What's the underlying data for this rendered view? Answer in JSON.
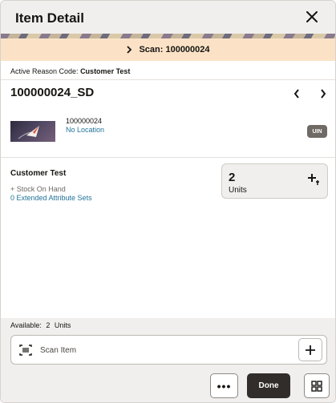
{
  "dialog": {
    "title": "Item Detail",
    "close_icon": "close-icon"
  },
  "scan_banner": {
    "label": "Scan: 100000024",
    "icon": "chevron-right-icon"
  },
  "reason": {
    "prefix": "Active Reason Code:",
    "value": "Customer Test"
  },
  "item": {
    "title": "100000024_SD",
    "number": "100000024",
    "location": "No Location",
    "badge": "UIN",
    "prev_icon": "chevron-left-icon",
    "next_icon": "chevron-right-icon"
  },
  "stock": {
    "reason_name": "Customer Test",
    "stock_label": "+ Stock On Hand",
    "extended_link": "0 Extended Attribute Sets",
    "quantity": "2",
    "unit": "Units"
  },
  "footer": {
    "available_label": "Available:",
    "available_value": "2",
    "available_unit": "Units",
    "scan_placeholder": "Scan Item",
    "more_label": "•••",
    "done_label": "Done"
  },
  "colors": {
    "banner": "#fbe2c6",
    "link": "#227399",
    "primary_button": "#312d2a",
    "header_bg": "#f1efed"
  }
}
